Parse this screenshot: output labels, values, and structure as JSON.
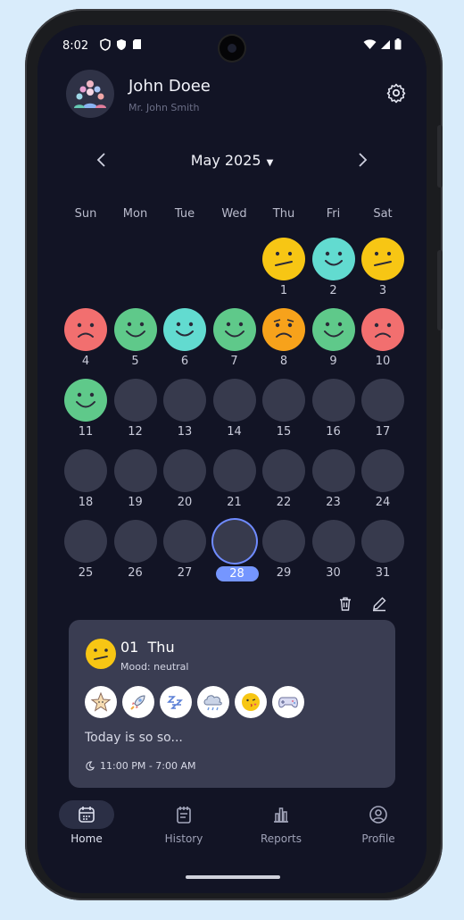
{
  "status_bar": {
    "time": "8:02"
  },
  "user": {
    "name": "John Doee",
    "subtitle": "Mr. John Smith"
  },
  "calendar": {
    "month_label": "May 2025",
    "weekdays": [
      "Sun",
      "Mon",
      "Tue",
      "Wed",
      "Thu",
      "Fri",
      "Sat"
    ],
    "first_weekday_index": 4,
    "days_in_month": 31,
    "today": 28,
    "moods": {
      "1": "neutral",
      "2": "happy-teal",
      "3": "neutral",
      "4": "sad-red",
      "5": "happy",
      "6": "happy-teal",
      "7": "happy",
      "8": "sad-orange",
      "9": "happy",
      "10": "sad-red",
      "11": "happy"
    },
    "mood_colors": {
      "neutral": "#f7c614",
      "happy": "#5fc98a",
      "happy-teal": "#62dbd0",
      "sad-red": "#f26f6f",
      "sad-orange": "#f7a21b",
      "empty": "#373a4d"
    }
  },
  "actions": {
    "delete_icon": "trash-icon",
    "edit_icon": "pencil-icon"
  },
  "entry": {
    "day": "01",
    "weekday": "Thu",
    "mood_label": "Mood: neutral",
    "activity_icons": [
      "starfish-icon",
      "rocket-icon",
      "sleep-zzz-icon",
      "cloud-rain-icon",
      "kiss-face-icon",
      "gamepad-icon"
    ],
    "note": "Today is so so...",
    "sleep_time": "11:00 PM - 7:00 AM"
  },
  "nav": {
    "items": [
      {
        "label": "Home",
        "icon": "calendar-icon",
        "active": true
      },
      {
        "label": "History",
        "icon": "notebook-icon",
        "active": false
      },
      {
        "label": "Reports",
        "icon": "bar-chart-icon",
        "active": false
      },
      {
        "label": "Profile",
        "icon": "user-circle-icon",
        "active": false
      }
    ]
  },
  "colors": {
    "background": "#121425",
    "accent": "#7596ff",
    "card": "#3a3d52"
  }
}
